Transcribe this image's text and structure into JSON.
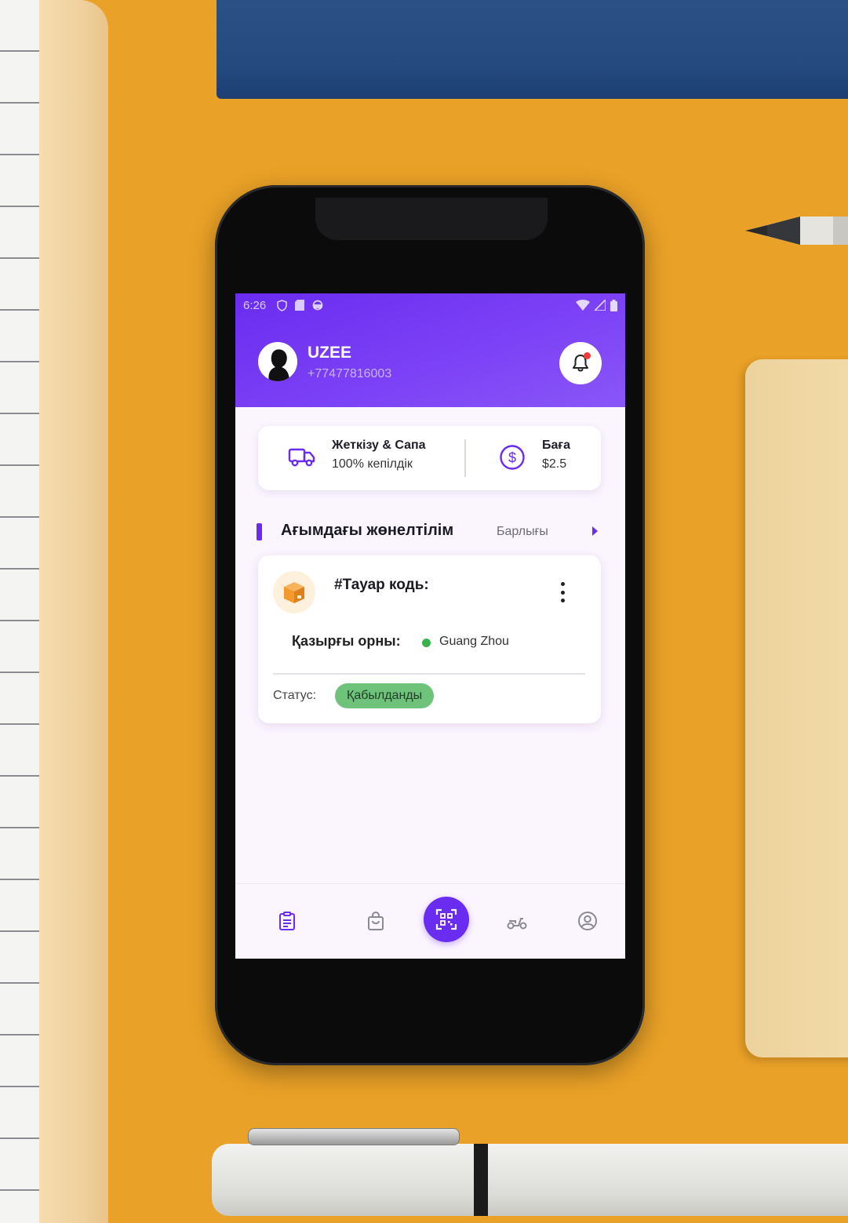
{
  "status_bar": {
    "time": "6:26"
  },
  "profile": {
    "name": "UZEE",
    "phone": "+77477816003"
  },
  "info_card": {
    "delivery_title": "Жеткізу & Сапа",
    "delivery_sub": "100% кепілдік",
    "price_title": "Баға",
    "price_value": "$2.5"
  },
  "current_shipments": {
    "title": "Ағымдағы жөнелтілім",
    "see_all": "Барлығы"
  },
  "shipment": {
    "code_label": "#Тауар кодь:",
    "location_label": "Қазырғы орны:",
    "location_value": "Guang Zhou",
    "status_label": "Статус:",
    "status_value": "Қабылданды"
  },
  "colors": {
    "accent": "#6a2cf0",
    "status_green": "#6ec27a",
    "location_dot": "#3cb04a"
  },
  "icons": {
    "notification": "bell-icon",
    "delivery": "truck-icon",
    "price": "dollar-icon",
    "shipment": "box-icon",
    "nav": [
      "clipboard-icon",
      "shopping-bag-icon",
      "qr-scan-icon",
      "scooter-icon",
      "user-circle-icon"
    ]
  }
}
